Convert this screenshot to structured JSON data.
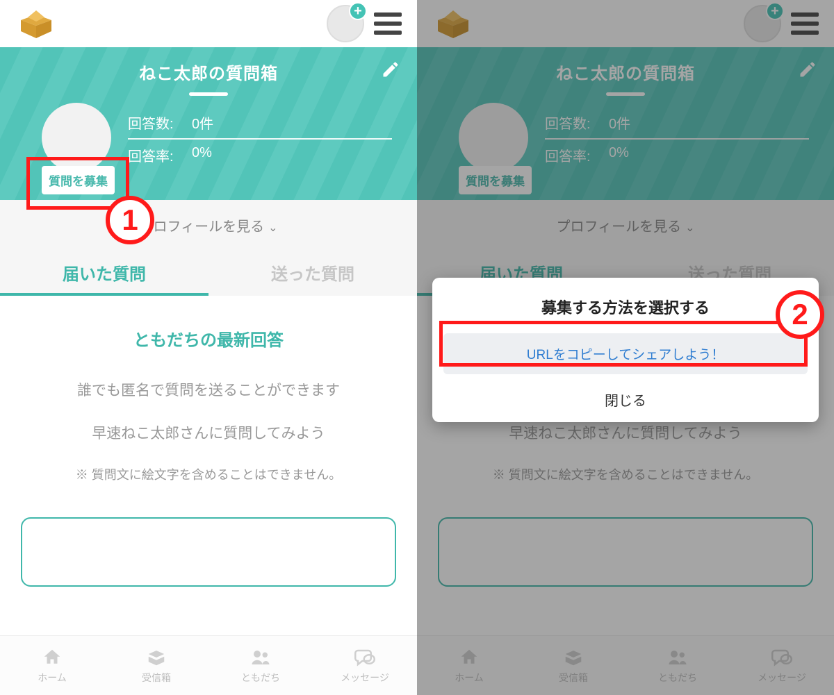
{
  "hero": {
    "title": "ねこ太郎の質問箱",
    "answers_label": "回答数:",
    "answers_value": "0件",
    "rate_label": "回答率:",
    "rate_value": "0%",
    "recruit_button": "質問を募集"
  },
  "profile_link": "プロフィールを見る",
  "tabs": {
    "received": "届いた質問",
    "sent": "送った質問"
  },
  "section_title": "ともだちの最新回答",
  "body": {
    "line1": "誰でも匿名で質問を送ることができます",
    "line2": "早速ねこ太郎さんに質問してみよう",
    "note": "※ 質問文に絵文字を含めることはできません。"
  },
  "nav": {
    "home": "ホーム",
    "inbox": "受信箱",
    "friends": "ともだち",
    "message": "メッセージ"
  },
  "modal": {
    "title": "募集する方法を選択する",
    "copy_button": "URLをコピーしてシェアしよう！",
    "close": "閉じる"
  },
  "annotations": {
    "step1": "1",
    "step2": "2"
  }
}
